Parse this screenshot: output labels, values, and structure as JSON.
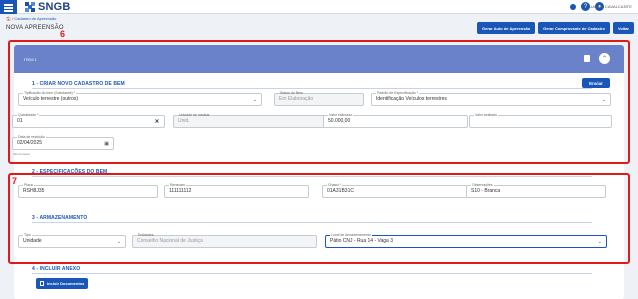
{
  "app": {
    "logo": "SNGB",
    "user": "LUANNE CAVALCANTE"
  },
  "breadcrumb": "🏠 / Cadastro de Apreensão",
  "page_title": "NOVA APREENSÃO",
  "actions": {
    "gerar_auto": "Gerar Auto de Apreensão",
    "gerar_comprovante": "Gerar Comprovante de Cadastro",
    "voltar": "Voltar"
  },
  "annotations": {
    "label_6": "6",
    "label_7": "7"
  },
  "item": {
    "title": "ITEM 1",
    "sections": {
      "criar": "1 - CRIAR NOVO CADASTRO DE BEM",
      "especificacoes": "2 - ESPECIFICAÇÕES DO BEM",
      "armazenamento": "3 - ARMAZENAMENTO",
      "anexo": "4 - INCLUIR ANEXO"
    },
    "enviar_label": "Enviar",
    "fields": {
      "tipificacao": {
        "label": "Tipificação do bem (Subclasse) *",
        "value": "Veículo terrestre (outros)"
      },
      "status": {
        "label": "Status do Bem",
        "value": "Em Elaboração"
      },
      "padrao": {
        "label": "Padrão de Especificação *",
        "value": "Identificação Veículos terrestres"
      },
      "quantidade": {
        "label": "Quantidade *",
        "value": "01"
      },
      "unidade_medida": {
        "label": "Unidade de medida",
        "value": "Unid."
      },
      "valor_estimado": {
        "label": "Valor estimado",
        "value": "50.000,00"
      },
      "valor_avaliado": {
        "label": "Valor avaliado",
        "value": ""
      },
      "data_restricao": {
        "label": "Data de restrição",
        "value": "02/04/2025",
        "help": "dd/mm/aaaa"
      },
      "placa": {
        "label": "Placa",
        "value": "RSH8J35"
      },
      "renavam": {
        "label": "Renavam",
        "value": "111111112"
      },
      "chassi": {
        "label": "Chassi *",
        "value": "01A31B31C"
      },
      "observacoes": {
        "label": "Observações",
        "value": "S10 - Branca"
      },
      "tipo": {
        "label": "Tipo",
        "value": "Unidade"
      },
      "entidades": {
        "label": "Entidades",
        "value": "Conselho Nacional de Justiça"
      },
      "local": {
        "label": "Local de Armazenamento",
        "value": "Pátio CNJ - Rua 14 - Vaga 3"
      }
    },
    "incluir_documentos": "Incluir Documentos"
  },
  "colors": {
    "primary": "#1a56b8",
    "header": "#6a82c9",
    "highlight": "#e01919"
  }
}
